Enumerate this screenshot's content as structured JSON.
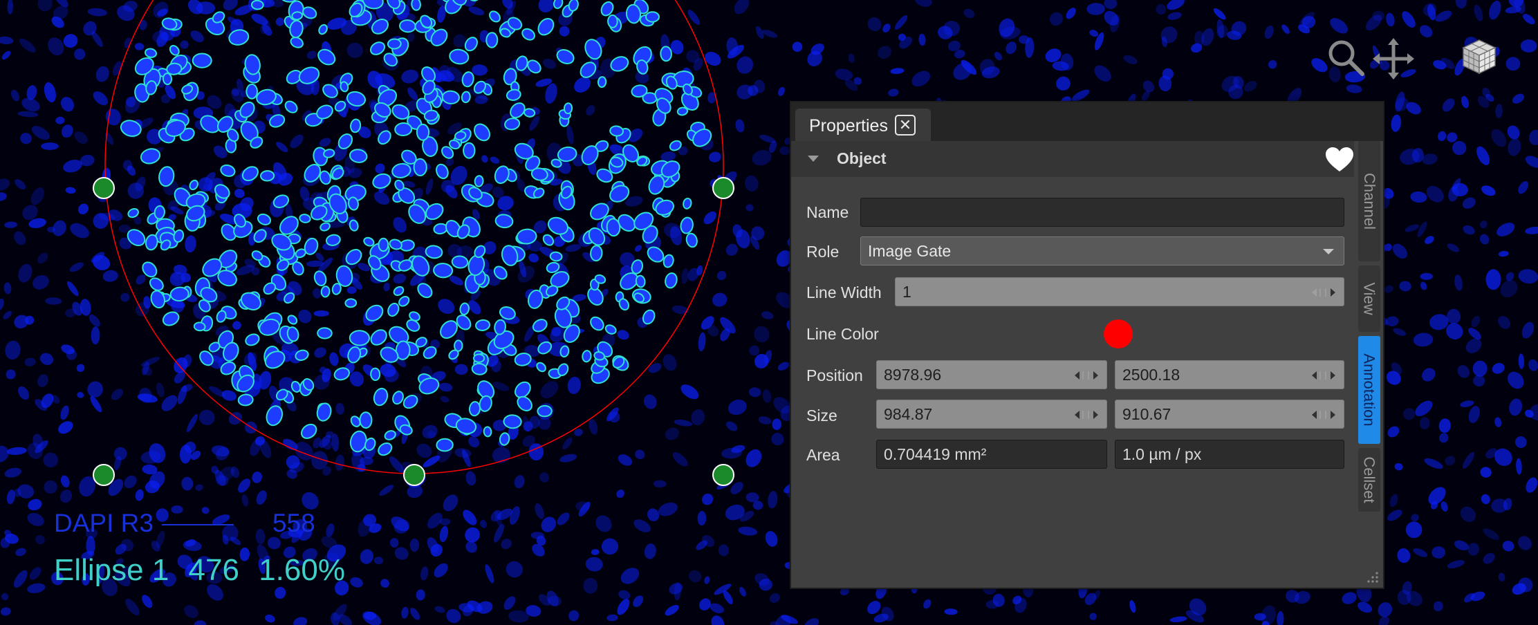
{
  "toolbar": {
    "icons": [
      "search-icon",
      "move-icon",
      "cube-icon"
    ]
  },
  "overlay": {
    "dapi_label": "DAPI R3",
    "dapi_count": "558",
    "gate_name": "Ellipse 1",
    "gate_count": "476",
    "gate_percent": "1.60%"
  },
  "panel": {
    "tab_label": "Properties",
    "close_label": "✕",
    "section_title": "Object",
    "section_icon": "heart-icon",
    "name_label": "Name",
    "name_value": "",
    "role_label": "Role",
    "role_value": "Image Gate",
    "line_width_label": "Line Width",
    "line_width_value": "1",
    "line_color_label": "Line Color",
    "line_color_value": "#ff0000",
    "position_label": "Position",
    "position_x": "8978.96",
    "position_y": "2500.18",
    "size_label": "Size",
    "size_w": "984.87",
    "size_h": "910.67",
    "area_label": "Area",
    "area_value": "0.704419 mm²",
    "scale_value": "1.0 µm / px",
    "side_tabs": [
      "Channel",
      "View",
      "Annotation",
      "Cellset"
    ],
    "active_side_tab": "Annotation"
  },
  "colors": {
    "nuclei": "#0a1ef0",
    "cell_outline": "#30e0d0",
    "gate_outline": "#ff0000",
    "handle": "#1a8a2a",
    "accent": "#1f8ae8"
  }
}
